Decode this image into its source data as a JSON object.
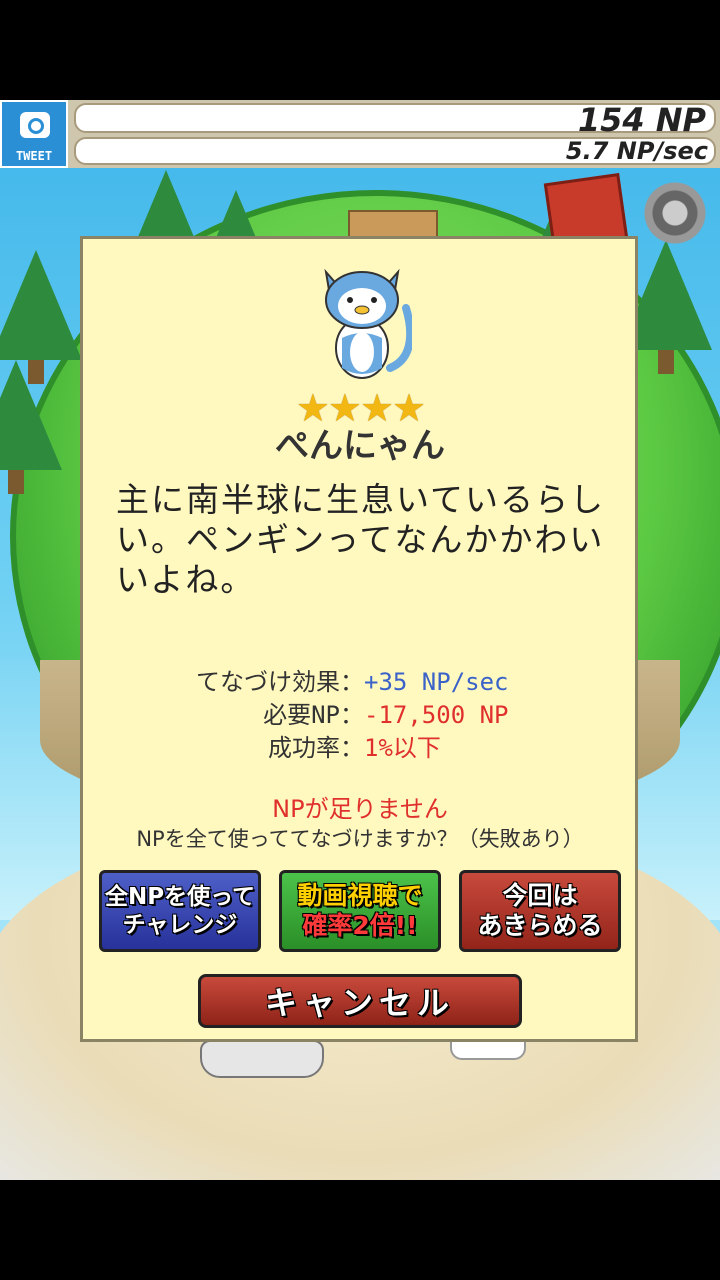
{
  "hud": {
    "tweet_label": "TWEET",
    "np_value": "154 NP",
    "np_rate": "5.7 NP/sec"
  },
  "dialog": {
    "rarity_stars": "★★★★",
    "rarity": 4,
    "name": "ぺんにゃん",
    "description": "主に南半球に生息いているらしい。ペンギンってなんかかわいいよね。",
    "stats": [
      {
        "label": "てなづけ効果",
        "value": "+35 NP/sec",
        "color": "#3a62c8"
      },
      {
        "label": "必要NP",
        "value": "-17,500 NP",
        "color": "#e0302c"
      },
      {
        "label": "成功率",
        "value": "1%以下",
        "color": "#e0302c"
      }
    ],
    "warning": "NPが足りません",
    "confirm": "NPを全て使っててなづけますか？（失敗あり）",
    "buttons": {
      "challenge_line1": "全NPを使って",
      "challenge_line2": "チャレンジ",
      "video_line1": "動画視聴で",
      "video_line2": "確率2倍!!",
      "giveup_line1": "今回は",
      "giveup_line2": "あきらめる",
      "cancel": "キャンセル"
    }
  },
  "icons": [
    "camera-icon",
    "gear-icon",
    "book-icon",
    "cat-icon"
  ],
  "colors": {
    "dialog_bg": "#fff9c0",
    "stat_blue": "#3a62c8",
    "stat_red": "#e0302c"
  }
}
